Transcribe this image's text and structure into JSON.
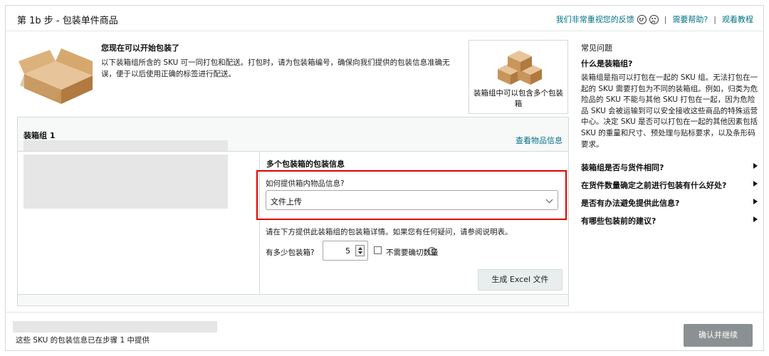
{
  "header": {
    "title": "第 1b 步 - 包装单件商品",
    "feedback": "我们非常重视您的反馈",
    "help": "需要帮助?",
    "tutorial": "观看教程"
  },
  "intro": {
    "title": "您现在可以开始包装了",
    "text": "以下装箱组所含的 SKU 可一同打包和配送。打包时，请为包装箱编号，确保向我们提供的包装信息准确无误，便于以后使用正确的标签进行配送。",
    "card_caption": "装箱组中可以包含多个包装箱"
  },
  "group": {
    "title": "装箱组 1",
    "view_items": "查看物品信息",
    "multi_box_title": "多个包装箱的包装信息",
    "question": "如何提供箱内物品信息?",
    "method_value": "文件上传",
    "detail_text": "请在下方提供此装箱组的包装箱详情。如果您有任何疑问，请参阅说明表。",
    "box_count_label": "有多少包装箱?",
    "box_count": "5",
    "no_exact_label": "不需要确切数量",
    "excel_button": "生成 Excel 文件"
  },
  "faq": {
    "heading": "常见问题",
    "q1": "什么是装箱组?",
    "a1": "装箱组是指可以打包在一起的 SKU 组。无法打包在一起的 SKU 需要打包为不同的装箱组。例如，归类为危险品的 SKU 不能与其他 SKU 打包在一起，因为危险品 SKU 会被运输到可以安全接收这些商品的特殊运营中心。决定 SKU 是否可以打包在一起的其他因素包括 SKU 的重量和尺寸、预处理与贴标要求，以及条形码要求。",
    "items": [
      "装箱组是否与货件相同?",
      "在货件数量确定之前进行包装有什么好处?",
      "是否有办法避免提供此信息?",
      "有哪些包装前的建议?"
    ]
  },
  "footer": {
    "text": "这些 SKU 的包装信息已在步骤 1 中提供",
    "confirm_button": "确认并继续"
  },
  "colors": {
    "link": "#007185",
    "highlight": "#e00000",
    "disabled_button": "#8b9192"
  }
}
